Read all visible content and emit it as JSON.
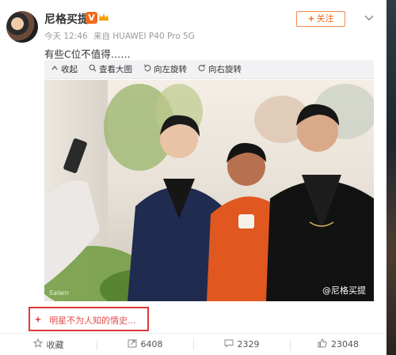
{
  "user": {
    "name": "尼格买提",
    "vip_badge": "V",
    "meta_time": "今天 12:46",
    "meta_source": "来自 HUAWEI P40 Pro 5G"
  },
  "post": {
    "text": "有些C位不值得……"
  },
  "header": {
    "follow_label": "关注",
    "follow_plus": "+"
  },
  "image_toolbar": {
    "items": [
      {
        "icon": "collapse-icon",
        "label": "收起"
      },
      {
        "icon": "zoom-icon",
        "label": "查看大图"
      },
      {
        "icon": "rotate-left-icon",
        "label": "向左旋转"
      },
      {
        "icon": "rotate-right-icon",
        "label": "向右旋转"
      }
    ]
  },
  "photo": {
    "watermark": "@尼格买提",
    "signature": "Salam"
  },
  "topic": {
    "label": "明星不为人知的情史..."
  },
  "actions": {
    "collect_label": "收藏",
    "repost_count": "6408",
    "comment_count": "2329",
    "like_count": "23048"
  },
  "colors": {
    "accent_orange": "#f26b1a",
    "topic_red": "#e64b4b",
    "highlight_border": "#e03a3a",
    "toolbar_bg": "#f2f2f5"
  }
}
